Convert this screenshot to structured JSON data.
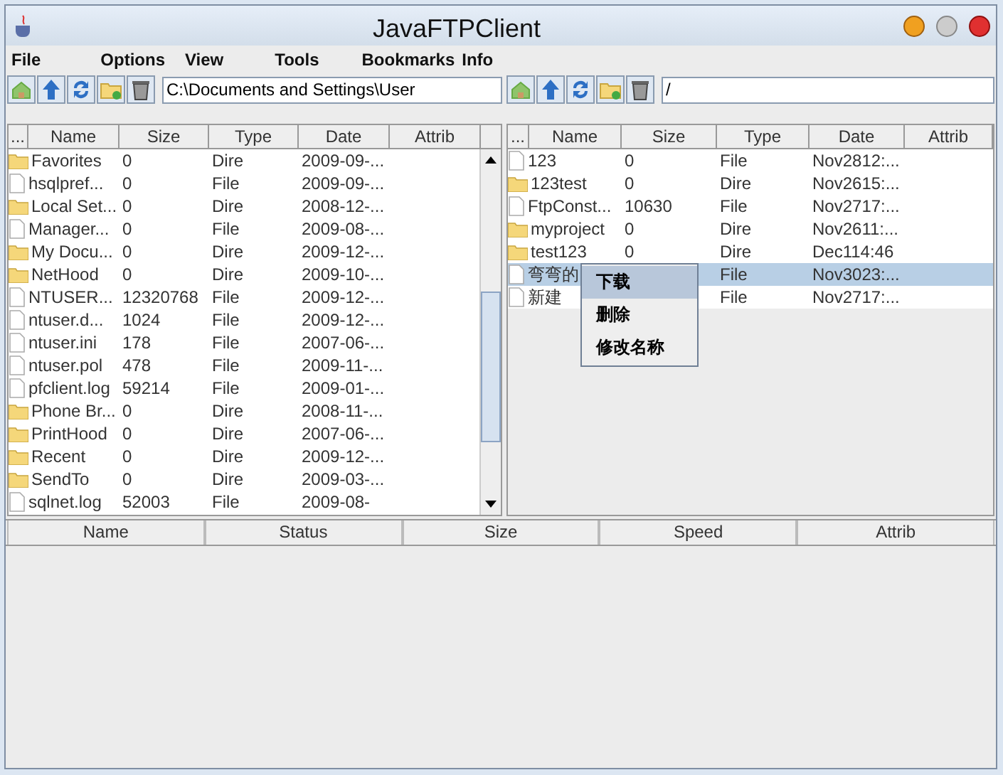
{
  "window": {
    "title": "JavaFTPClient"
  },
  "menu": [
    "File",
    "Options",
    "View",
    "Tools",
    "Bookmarks",
    "Info"
  ],
  "local": {
    "path": "C:\\Documents and Settings\\User",
    "columns": [
      "...",
      "Name",
      "Size",
      "Type",
      "Date",
      "Attrib"
    ],
    "rows": [
      {
        "kind": "folder",
        "name": "Favorites",
        "size": "0",
        "type": "Dire",
        "date": "2009-09-..."
      },
      {
        "kind": "file",
        "name": "hsqlpref...",
        "size": "0",
        "type": "File",
        "date": "2009-09-..."
      },
      {
        "kind": "folder",
        "name": "Local Set...",
        "size": "0",
        "type": "Dire",
        "date": "2008-12-..."
      },
      {
        "kind": "file",
        "name": "Manager...",
        "size": "0",
        "type": "File",
        "date": "2009-08-..."
      },
      {
        "kind": "folder",
        "name": "My Docu...",
        "size": "0",
        "type": "Dire",
        "date": "2009-12-..."
      },
      {
        "kind": "folder",
        "name": "NetHood",
        "size": "0",
        "type": "Dire",
        "date": "2009-10-..."
      },
      {
        "kind": "file",
        "name": "NTUSER...",
        "size": "12320768",
        "type": "File",
        "date": "2009-12-..."
      },
      {
        "kind": "file",
        "name": "ntuser.d...",
        "size": "1024",
        "type": "File",
        "date": "2009-12-..."
      },
      {
        "kind": "file",
        "name": "ntuser.ini",
        "size": "178",
        "type": "File",
        "date": "2007-06-..."
      },
      {
        "kind": "file",
        "name": "ntuser.pol",
        "size": "478",
        "type": "File",
        "date": "2009-11-..."
      },
      {
        "kind": "file",
        "name": "pfclient.log",
        "size": "59214",
        "type": "File",
        "date": "2009-01-..."
      },
      {
        "kind": "folder",
        "name": "Phone Br...",
        "size": "0",
        "type": "Dire",
        "date": "2008-11-..."
      },
      {
        "kind": "folder",
        "name": "PrintHood",
        "size": "0",
        "type": "Dire",
        "date": "2007-06-..."
      },
      {
        "kind": "folder",
        "name": "Recent",
        "size": "0",
        "type": "Dire",
        "date": "2009-12-..."
      },
      {
        "kind": "folder",
        "name": "SendTo",
        "size": "0",
        "type": "Dire",
        "date": "2009-03-..."
      },
      {
        "kind": "file",
        "name": "sqlnet.log",
        "size": "52003",
        "type": "File",
        "date": "2009-08-"
      }
    ]
  },
  "remote": {
    "path": "/",
    "columns": [
      "...",
      "Name",
      "Size",
      "Type",
      "Date",
      "Attrib"
    ],
    "rows": [
      {
        "kind": "file",
        "name": "123",
        "size": "0",
        "type": "File",
        "date": "Nov2812:...",
        "selected": false
      },
      {
        "kind": "folder",
        "name": "123test",
        "size": "0",
        "type": "Dire",
        "date": "Nov2615:...",
        "selected": false
      },
      {
        "kind": "file",
        "name": "FtpConst...",
        "size": "10630",
        "type": "File",
        "date": "Nov2717:...",
        "selected": false
      },
      {
        "kind": "folder",
        "name": "myproject",
        "size": "0",
        "type": "Dire",
        "date": "Nov2611:...",
        "selected": false
      },
      {
        "kind": "folder",
        "name": "test123",
        "size": "0",
        "type": "Dire",
        "date": "Dec114:46",
        "selected": false
      },
      {
        "kind": "file",
        "name": "弯弯的",
        "type": "File",
        "date": "Nov3023:...",
        "selected": true
      },
      {
        "kind": "file",
        "name": "新建",
        "type": "File",
        "date": "Nov2717:...",
        "selected": false
      }
    ]
  },
  "context_menu": [
    {
      "label": "下载",
      "selected": true
    },
    {
      "label": "删除",
      "selected": false
    },
    {
      "label": "修改名称",
      "selected": false
    }
  ],
  "transfers": {
    "columns": [
      "Name",
      "Status",
      "Size",
      "Speed",
      "Attrib"
    ]
  }
}
